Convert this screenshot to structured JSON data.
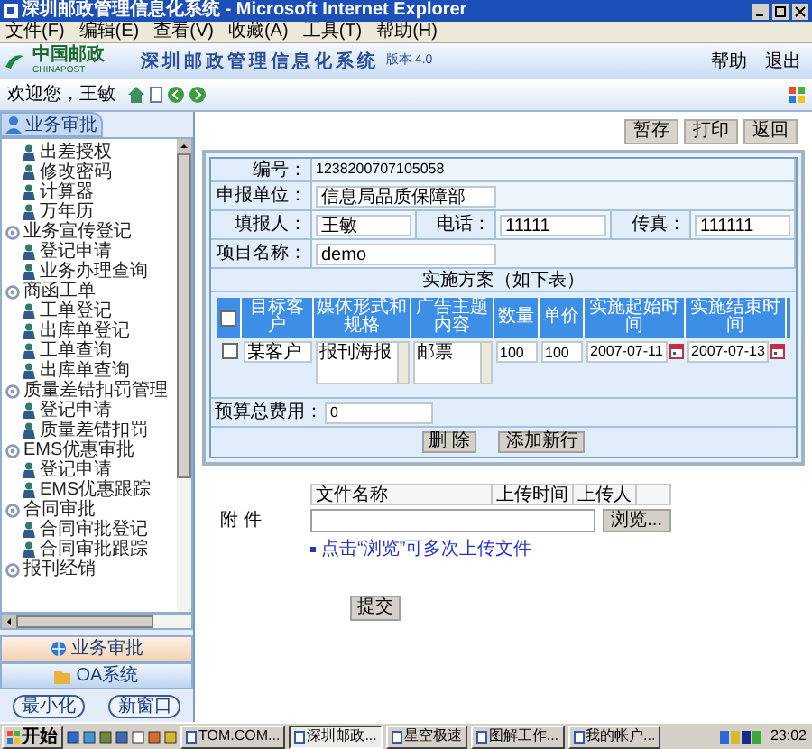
{
  "window": {
    "title": "深圳邮政管理信息化系统 - Microsoft Internet Explorer"
  },
  "menu": [
    "文件(F)",
    "编辑(E)",
    "查看(V)",
    "收藏(A)",
    "工具(T)",
    "帮助(H)"
  ],
  "header": {
    "logo": "中国邮政",
    "logo_sub": "CHINAPOST",
    "title": "深圳邮政管理信息化系统",
    "version": "版本 4.0",
    "links": [
      "帮助",
      "退出"
    ]
  },
  "toolbar": {
    "welcome": "欢迎您，王敏"
  },
  "sidebar": {
    "tab": "业务审批",
    "items": [
      {
        "label": "出差授权"
      },
      {
        "label": "修改密码"
      },
      {
        "label": "计算器"
      },
      {
        "label": "万年历"
      },
      {
        "label": "业务宣传登记",
        "children": [
          {
            "label": "登记申请"
          },
          {
            "label": "业务办理查询"
          }
        ]
      },
      {
        "label": "商函工单",
        "children": [
          {
            "label": "工单登记"
          },
          {
            "label": "出库单登记"
          },
          {
            "label": "工单查询"
          },
          {
            "label": "出库单查询"
          }
        ]
      },
      {
        "label": "质量差错扣罚管理",
        "children": [
          {
            "label": "登记申请"
          },
          {
            "label": "质量差错扣罚"
          }
        ]
      },
      {
        "label": "EMS优惠审批",
        "children": [
          {
            "label": "登记申请"
          },
          {
            "label": "EMS优惠跟踪"
          }
        ]
      },
      {
        "label": "合同审批",
        "children": [
          {
            "label": "合同审批登记"
          },
          {
            "label": "合同审批跟踪"
          }
        ]
      },
      {
        "label": "报刊经销",
        "kind": "group"
      }
    ],
    "modules": [
      {
        "label": "业务审批",
        "selected": true
      },
      {
        "label": "OA系统",
        "selected": false
      }
    ],
    "footer_buttons": [
      "最小化",
      "新窗口"
    ]
  },
  "actions": [
    "暂存",
    "打印",
    "返回"
  ],
  "form": {
    "number": {
      "label": "编号：",
      "value": "1238200707105058"
    },
    "unit": {
      "label": "申报单位：",
      "value": "信息局品质保障部"
    },
    "filler": {
      "label": "填报人：",
      "value": "王敏"
    },
    "phone": {
      "label": "电话：",
      "value": "11111"
    },
    "fax": {
      "label": "传真：",
      "value": "111111"
    },
    "project": {
      "label": "项目名称：",
      "value": "demo"
    },
    "plan_title": "实施方案（如下表）",
    "header_checked": false,
    "plan_columns": [
      "目标客户",
      "媒体形式和规格",
      "广告主题内容",
      "数量",
      "单价",
      "实施起始时间",
      "实施结束时间"
    ],
    "plan_rows": [
      {
        "checked": false,
        "cells": [
          "某客户",
          "报刊海报",
          "邮票",
          "100",
          "100",
          "2007-07-11",
          "2007-07-13"
        ]
      }
    ],
    "budget": {
      "label": "预算总费用：",
      "value": "0"
    },
    "plan_buttons": [
      "删 除",
      "添加新行"
    ]
  },
  "attachments": {
    "columns": [
      "文件名称",
      "上传时间",
      "上传人"
    ],
    "label": "附 件",
    "browse": "浏览...",
    "hint": "点击“浏览”可多次上传文件"
  },
  "submit": "提交",
  "taskbar": {
    "start": "开始",
    "tasks": [
      {
        "label": "TOM.COM...",
        "selected": false
      },
      {
        "label": "深圳邮政...",
        "selected": true
      },
      {
        "label": "星空极速",
        "selected": false
      },
      {
        "label": "图解工作...",
        "selected": false
      },
      {
        "label": "我的帐户...",
        "selected": false
      }
    ],
    "clock": "23:02"
  }
}
